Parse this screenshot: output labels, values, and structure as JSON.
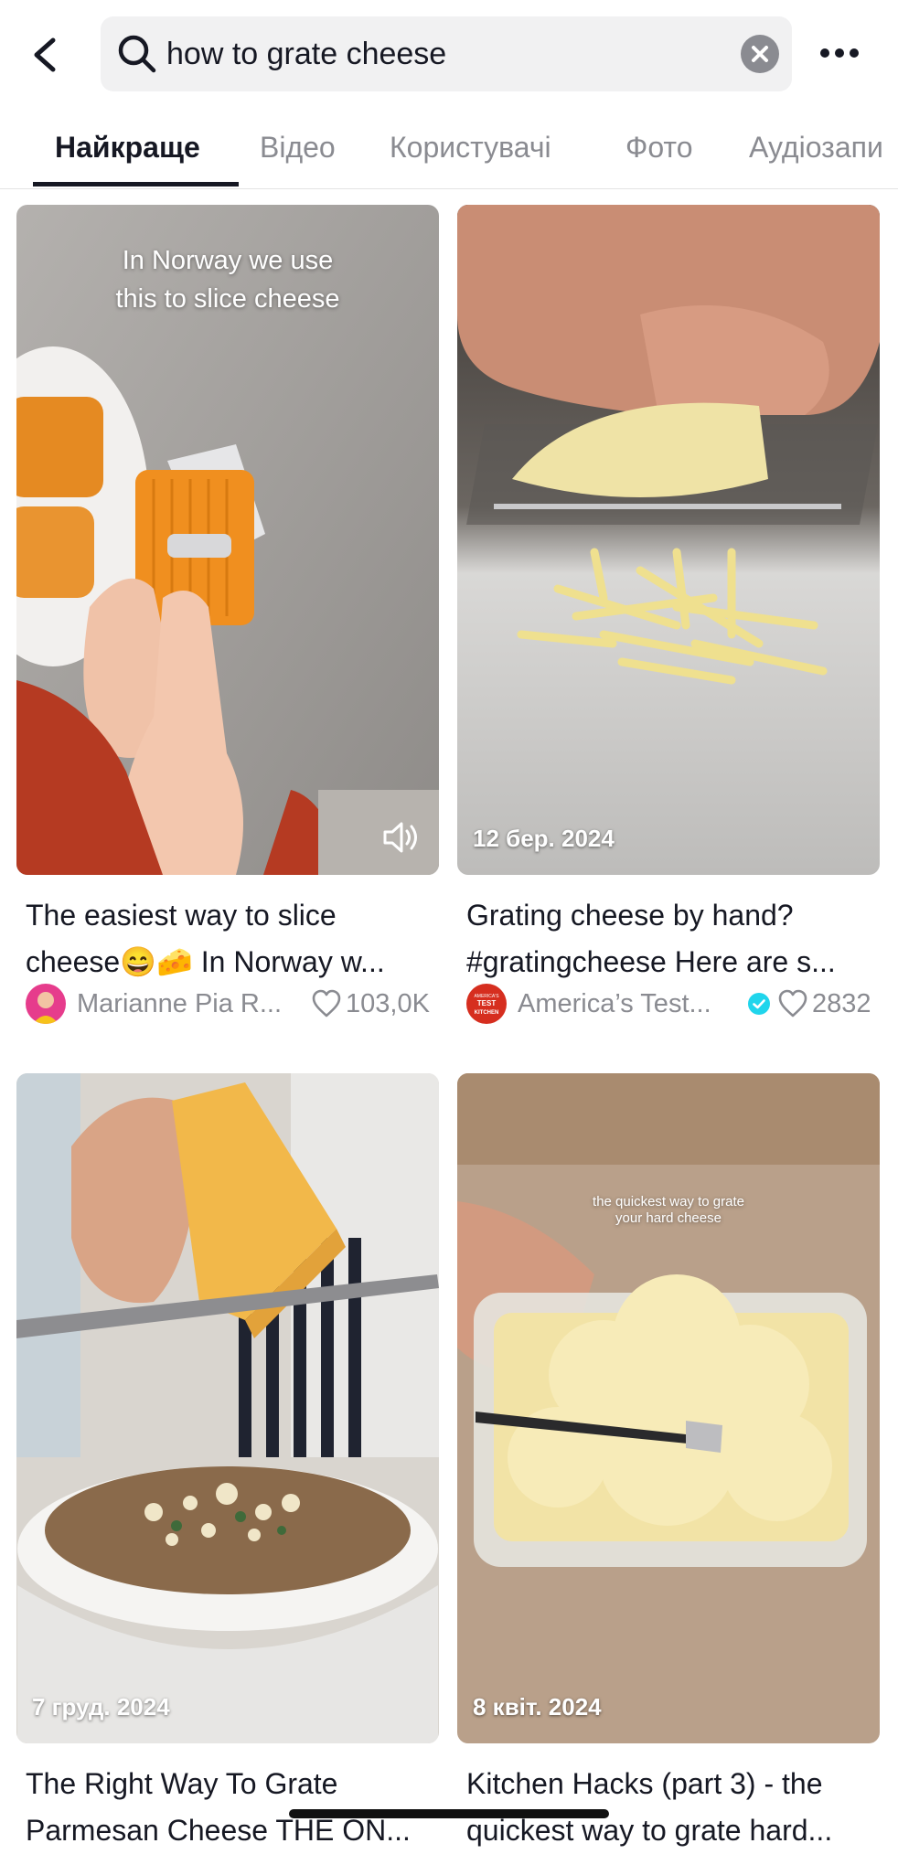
{
  "search": {
    "query": "how to grate cheese"
  },
  "tabs": [
    {
      "label": "Найкраще",
      "active": true
    },
    {
      "label": "Відео"
    },
    {
      "label": "Користувачі"
    },
    {
      "label": "Фото"
    },
    {
      "label": "Аудіозапи"
    }
  ],
  "results": [
    {
      "overlay_line1": "In Norway we use",
      "overlay_line2": "this to slice cheese",
      "desc_line1": "The easiest way to slice",
      "desc_line2": "cheese😄🧀 In Norway w...",
      "author": "Marianne Pia R...",
      "likes": "103,0K",
      "sound_icon": "speaker-icon"
    },
    {
      "date": "12 бер. 2024",
      "desc_line1": "Grating cheese by hand?",
      "desc_line2": "#gratingcheese Here are s...",
      "author": "America’s Test...",
      "avatar_line1": "AMERICA'S",
      "avatar_line2": "TEST",
      "avatar_line3": "KITCHEN",
      "verified": true,
      "likes": "2832"
    },
    {
      "date": "7 груд. 2024",
      "desc_line1": "The Right Way To Grate",
      "desc_line2": "Parmesan Cheese THE ON..."
    },
    {
      "date": "8 квіт. 2024",
      "overlay_line1": "the quickest way to grate",
      "overlay_line2": "your hard cheese",
      "desc_line1": "Kitchen Hacks (part 3) - the",
      "desc_line2": "quickest way to grate hard..."
    }
  ],
  "colors": {
    "text_primary": "#161823",
    "text_secondary": "#8a8b91",
    "verified_blue": "#20d5ec"
  }
}
